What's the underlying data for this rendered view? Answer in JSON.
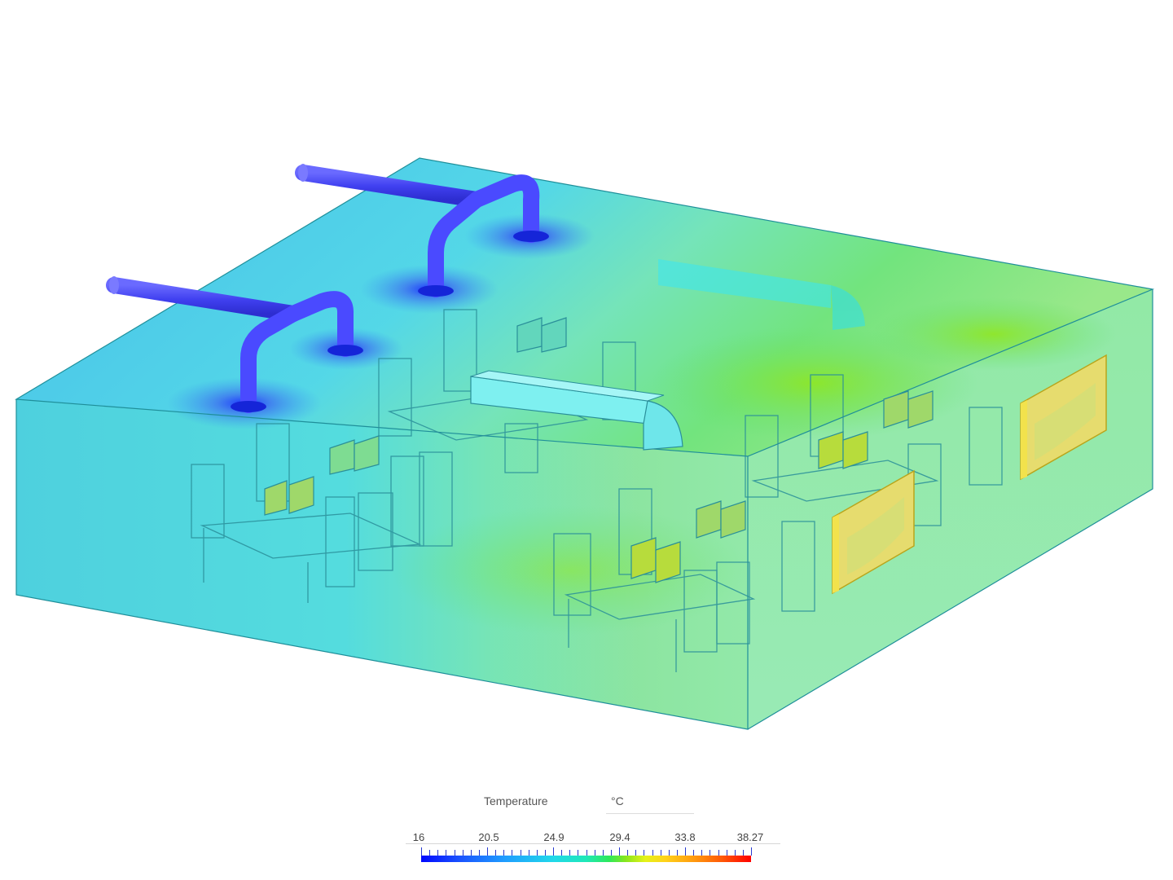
{
  "legend": {
    "title": "Temperature",
    "unit": "°C",
    "tick_labels": [
      "16",
      "20.5",
      "24.9",
      "29.4",
      "33.8",
      "38.27"
    ]
  },
  "colors": {
    "cold": "#0008ff",
    "cyan": "#21d8ea",
    "green": "#2ee85a",
    "yellow": "#e6f219",
    "hot": "#ff0000",
    "room_fill": "#33d0d8",
    "supply_duct": "#4a4aff",
    "heater_panel": "#f0e27a",
    "return_duct": "#7ef0f0"
  },
  "scene": {
    "room": "cuboid-room",
    "supply_ducts": 2,
    "diffusers": 4,
    "return_duct": 1,
    "heater_panels": 2,
    "desk_groups": 4
  }
}
